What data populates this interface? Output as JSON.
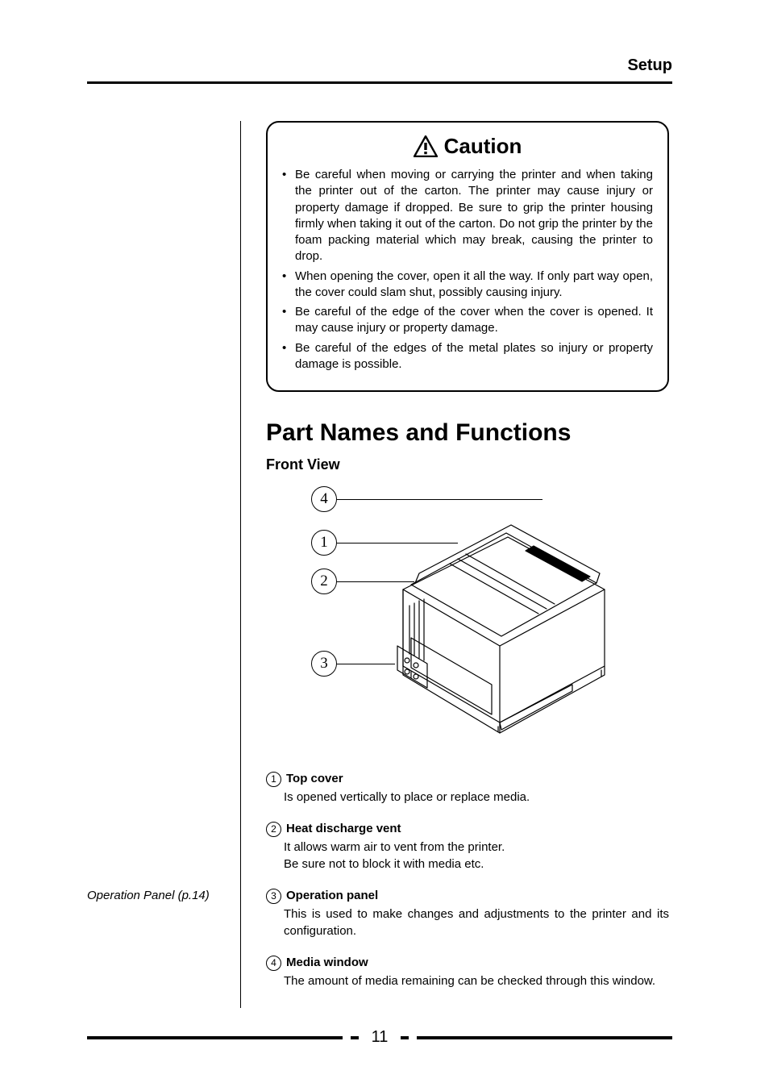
{
  "header": {
    "title": "Setup"
  },
  "caution": {
    "title": "Caution",
    "items": [
      "Be careful when moving or carrying the printer and when taking the printer out of the carton. The printer may cause injury or property damage if dropped. Be sure to grip the printer housing firmly when taking it out of the carton. Do not grip the printer by the foam packing material which may break, causing the printer to drop.",
      "When opening the cover, open it all the way. If only part way open, the cover could slam shut, possibly causing injury.",
      "Be careful of the edge of the cover when the cover is opened. It may cause injury or property damage.",
      "Be careful of the edges of the metal plates so injury or property damage is possible."
    ]
  },
  "section": {
    "heading": "Part Names and Functions",
    "subheading": "Front View"
  },
  "callouts": {
    "1": "1",
    "2": "2",
    "3": "3",
    "4": "4"
  },
  "sidebar": {
    "note": "Operation Panel (p.14)"
  },
  "parts": [
    {
      "num": "1",
      "title": "Top cover",
      "desc": "Is opened vertically to place or replace media."
    },
    {
      "num": "2",
      "title": "Heat discharge vent",
      "desc": "It allows warm air to vent from the printer.\nBe sure not to block it with media etc."
    },
    {
      "num": "3",
      "title": "Operation panel",
      "desc": "This is used to make changes and adjustments to the printer and its configuration."
    },
    {
      "num": "4",
      "title": "Media window",
      "desc": "The amount of media remaining can be checked through this window."
    }
  ],
  "page_number": "11"
}
